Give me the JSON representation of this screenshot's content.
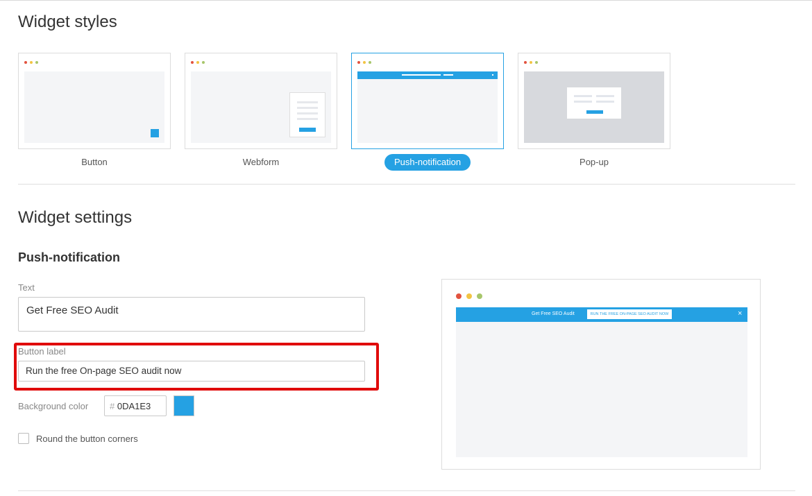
{
  "widget_styles": {
    "title": "Widget styles",
    "options": [
      {
        "label": "Button"
      },
      {
        "label": "Webform"
      },
      {
        "label": "Push-notification",
        "selected": true
      },
      {
        "label": "Pop-up"
      }
    ]
  },
  "widget_settings": {
    "title": "Widget settings",
    "subtitle": "Push-notification",
    "text_label": "Text",
    "text_value": "Get Free SEO Audit",
    "button_label_label": "Button label",
    "button_label_value": "Run the free On-page SEO audit now",
    "background_color_label": "Background color",
    "background_color_hash": "#",
    "background_color_value": "0DA1E3",
    "round_corners_label": "Round the button corners",
    "round_corners_checked": false
  },
  "preview": {
    "bar_text": "Get Free SEO Audit",
    "bar_button": "Run the free On-page SEO audit now",
    "close_glyph": "×"
  },
  "colors": {
    "accent": "#25a1e3",
    "highlight": "#e00b0b",
    "dot_red": "#e2533f",
    "dot_yellow": "#f2c443",
    "dot_green": "#a7c66b"
  },
  "icons": [
    "close-icon",
    "window-dots-icon"
  ]
}
